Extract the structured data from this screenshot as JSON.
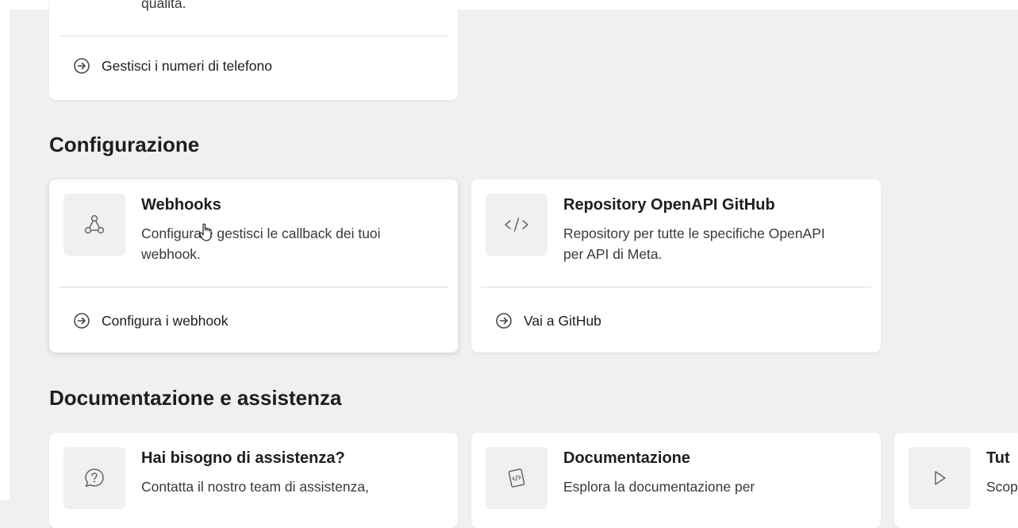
{
  "phone_card": {
    "clipped_desc_tail": "qualità.",
    "link_label": "Gestisci i numeri di telefono"
  },
  "configurazione": {
    "heading": "Configurazione",
    "cards": [
      {
        "title": "Webhooks",
        "description": "Configura e gestisci le callback dei tuoi webhook.",
        "link_label": "Configura i webhook",
        "icon": "webhook-icon"
      },
      {
        "title": "Repository OpenAPI GitHub",
        "description": "Repository per tutte le specifiche OpenAPI per API di Meta.",
        "link_label": "Vai a GitHub",
        "icon": "code-icon"
      }
    ]
  },
  "documentazione": {
    "heading": "Documentazione e assistenza",
    "cards": [
      {
        "title": "Hai bisogno di assistenza?",
        "description": "Contatta il nostro team di assistenza,",
        "icon": "help-icon"
      },
      {
        "title": "Documentazione",
        "description": "Esplora la documentazione per",
        "icon": "document-icon"
      },
      {
        "title": "Tut",
        "description": "Scop",
        "icon": "play-icon"
      }
    ]
  },
  "colors": {
    "page_bg": "#f0f0f0",
    "card_bg": "#ffffff",
    "icon_box_bg": "#f0f0f0",
    "divider": "#dadde1",
    "text": "#1c1e21"
  }
}
